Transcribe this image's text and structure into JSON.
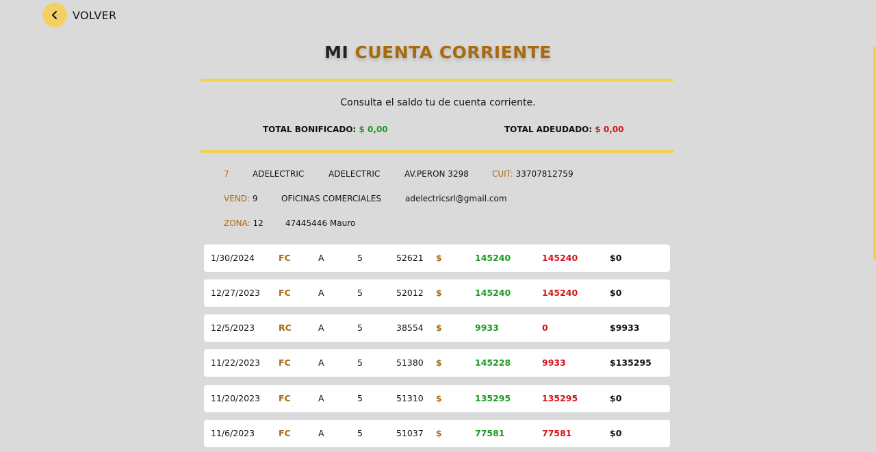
{
  "nav": {
    "back_label": "VOLVER"
  },
  "header": {
    "title_part1": "MI",
    "title_part2": "CUENTA CORRIENTE",
    "subtitle": "Consulta el saldo tu de cuenta corriente."
  },
  "totals": {
    "bonificado_label": "TOTAL BONIFICADO:",
    "bonificado_value": "$ 0,00",
    "adeudado_label": "TOTAL ADEUDADO:",
    "adeudado_value": "$ 0,00"
  },
  "client": {
    "id": "7",
    "name1": "ADELECTRIC",
    "name2": "ADELECTRIC",
    "address": "AV.PERON 3298",
    "cuit_label": "CUIT:",
    "cuit": "33707812759",
    "vend_label": "VEND:",
    "vend": "9",
    "office": "OFICINAS COMERCIALES",
    "email": "adelectricsrl@gmail.com",
    "zona_label": "ZONA:",
    "zona": "12",
    "contact": "47445446 Mauro"
  },
  "rows": [
    {
      "date": "1/30/2024",
      "type": "FC",
      "letter": "A",
      "pv": "5",
      "number": "52621",
      "currency": "$",
      "haber": "145240",
      "debe": "145240",
      "saldo": "$0"
    },
    {
      "date": "12/27/2023",
      "type": "FC",
      "letter": "A",
      "pv": "5",
      "number": "52012",
      "currency": "$",
      "haber": "145240",
      "debe": "145240",
      "saldo": "$0"
    },
    {
      "date": "12/5/2023",
      "type": "RC",
      "letter": "A",
      "pv": "5",
      "number": "38554",
      "currency": "$",
      "haber": "9933",
      "debe": "0",
      "saldo": "$9933"
    },
    {
      "date": "11/22/2023",
      "type": "FC",
      "letter": "A",
      "pv": "5",
      "number": "51380",
      "currency": "$",
      "haber": "145228",
      "debe": "9933",
      "saldo": "$135295"
    },
    {
      "date": "11/20/2023",
      "type": "FC",
      "letter": "A",
      "pv": "5",
      "number": "51310",
      "currency": "$",
      "haber": "135295",
      "debe": "135295",
      "saldo": "$0"
    },
    {
      "date": "11/6/2023",
      "type": "FC",
      "letter": "A",
      "pv": "5",
      "number": "51037",
      "currency": "$",
      "haber": "77581",
      "debe": "77581",
      "saldo": "$0"
    }
  ],
  "colors": {
    "accent": "#f3cf4a",
    "brand_text": "#a86a0c",
    "positive": "#1b9a22",
    "negative": "#d4141a"
  }
}
